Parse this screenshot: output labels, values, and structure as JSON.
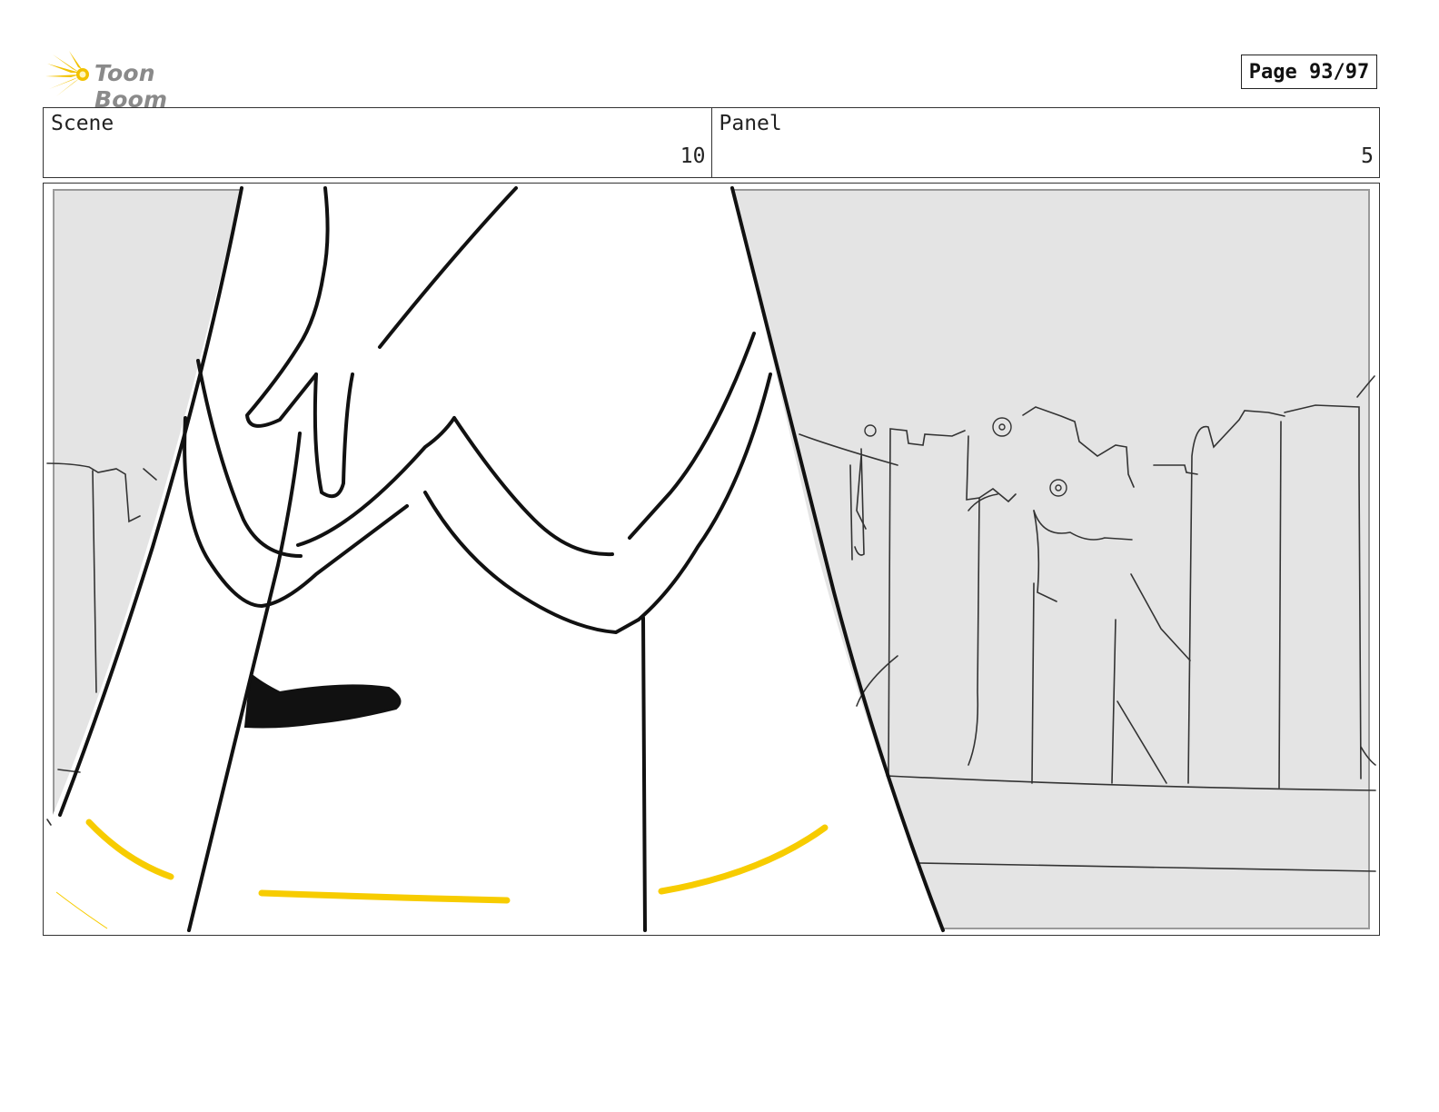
{
  "header": {
    "logo_text": "Toon Boom",
    "page_label": "Page 93/97"
  },
  "info": {
    "scene_label": "Scene",
    "scene_value": "10",
    "panel_label": "Panel",
    "panel_value": "5"
  },
  "colors": {
    "logo_accent": "#f2c200",
    "sketch_highlight": "#f7cc00",
    "background_gray": "#e4e4e4"
  }
}
